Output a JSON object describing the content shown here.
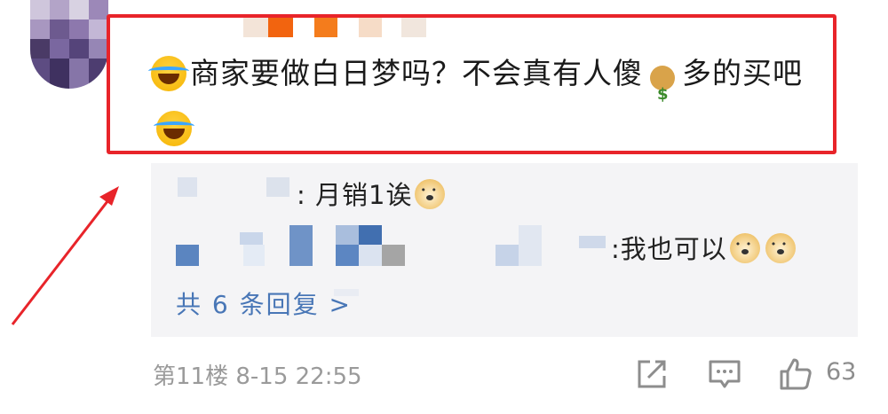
{
  "comment": {
    "text_part1": "商家要做白日梦吗？不会真有人傻",
    "text_part2": "多的买吧",
    "emoji_laugh": "laughing-crying-face-icon",
    "emoji_money": "money-bag-icon"
  },
  "replies": {
    "reply1_text": ": 月销1诶",
    "reply2_text": ":我也可以",
    "more_label": "共 6 条回复 >",
    "emoji_dog": "doge-face-icon"
  },
  "footer": {
    "floor_time": "第11楼  8-15 22:55",
    "like_count": "63"
  },
  "colors": {
    "highlight": "#e8242a",
    "link": "#4876b6",
    "reply_bg": "#f4f4f6",
    "meta_text": "#9a9a9a"
  }
}
